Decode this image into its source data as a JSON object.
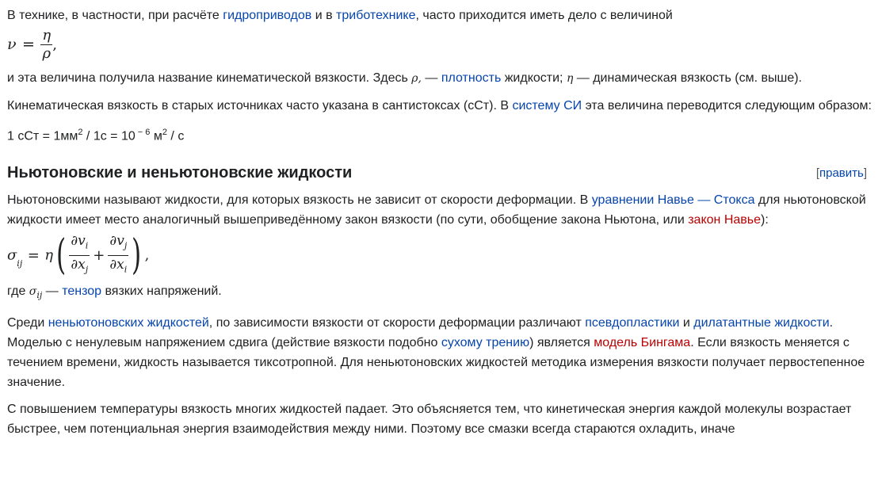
{
  "p1": {
    "t1": "В технике, в частности, при расчёте ",
    "link_hydraulic": "гидроприводов",
    "t2": " и в ",
    "link_tribo": "триботехнике",
    "t3": ", часто приходится иметь дело с величиной"
  },
  "formula1": {
    "lhs": "ν",
    "eq": "=",
    "num": "η",
    "den": "ρ",
    "tail": ","
  },
  "p2": {
    "t1": "и эта величина получила название кинематической вязкости. Здесь ",
    "rho": "ρ,",
    "t2": " — ",
    "link_density": "плотность",
    "t3": " жидкости; ",
    "eta": "η",
    "t4": " — динамическая вязкость (см. выше)."
  },
  "p3": {
    "t1": "Кинематическая вязкость в старых источниках часто указана в сантистоксах (сСт). В ",
    "link_si": "систему СИ",
    "t2": " эта величина переводится следующим образом:"
  },
  "p4": {
    "t1": "1 сСт = 1мм",
    "sup1": "2",
    "t2": " / 1c = 10",
    "sup2": " − 6",
    "t3": " м",
    "sup3": "2",
    "t4": " / c"
  },
  "section": {
    "title": "Ньютоновские и неньютоновские жидкости",
    "edit_open": "[",
    "edit_label": "править",
    "edit_close": "]"
  },
  "p5": {
    "t1": "Ньютоновскими называют жидкости, для которых вязкость не зависит от скорости деформации. В ",
    "link_ns": "уравнении Навье — Стокса",
    "t2": " для ньютоновской жидкости имеет место аналогичный вышеприведённому закон вязкости (по сути, обобщение закона Ньютона, или ",
    "link_navier": "закон Навье",
    "t3": "):"
  },
  "formula2": {
    "sigma": "σ",
    "ij": "ij",
    "eq": "=",
    "eta": "η",
    "lparen": "(",
    "num1": "∂v",
    "num1_sub": "i",
    "den1": "∂x",
    "den1_sub": "j",
    "plus": "+",
    "num2": "∂v",
    "num2_sub": "j",
    "den2": "∂x",
    "den2_sub": "i",
    "rparen": ")",
    "tail": ","
  },
  "p6": {
    "t1": "где ",
    "sigma": "σ",
    "ij": "ij",
    "t2": " — ",
    "link_tensor": "тензор",
    "t3": " вязких напряжений."
  },
  "p7": {
    "t1": "Среди ",
    "link_nonnewton": "неньютоновских жидкостей",
    "t2": ", по зависимости вязкости от скорости деформации различают ",
    "link_pseudo": "псевдопластики",
    "t3": " и ",
    "link_dilatant": "дилатантные жидкости",
    "t4": ". Моделью с ненулевым напряжением сдвига (действие вязкости подобно ",
    "link_dry": "сухому трению",
    "t5": ") является ",
    "link_bingham": "модель Бингама",
    "t6": ". Если вязкость меняется с течением времени, жидкость называется тиксотропной. Для неньютоновских жидкостей методика измерения вязкости получает первостепенное значение."
  },
  "p8": {
    "t1": "С повышением температуры вязкость многих жидкостей падает. Это объясняется тем, что кинетическая энергия каждой молекулы возрастает быстрее, чем потенциальная энергия взаимодействия между ними. Поэтому все смазки всегда стараются охладить, иначе"
  },
  "colors": {
    "link": "#0645ad",
    "redlink": "#ba0000",
    "text": "#202122"
  }
}
